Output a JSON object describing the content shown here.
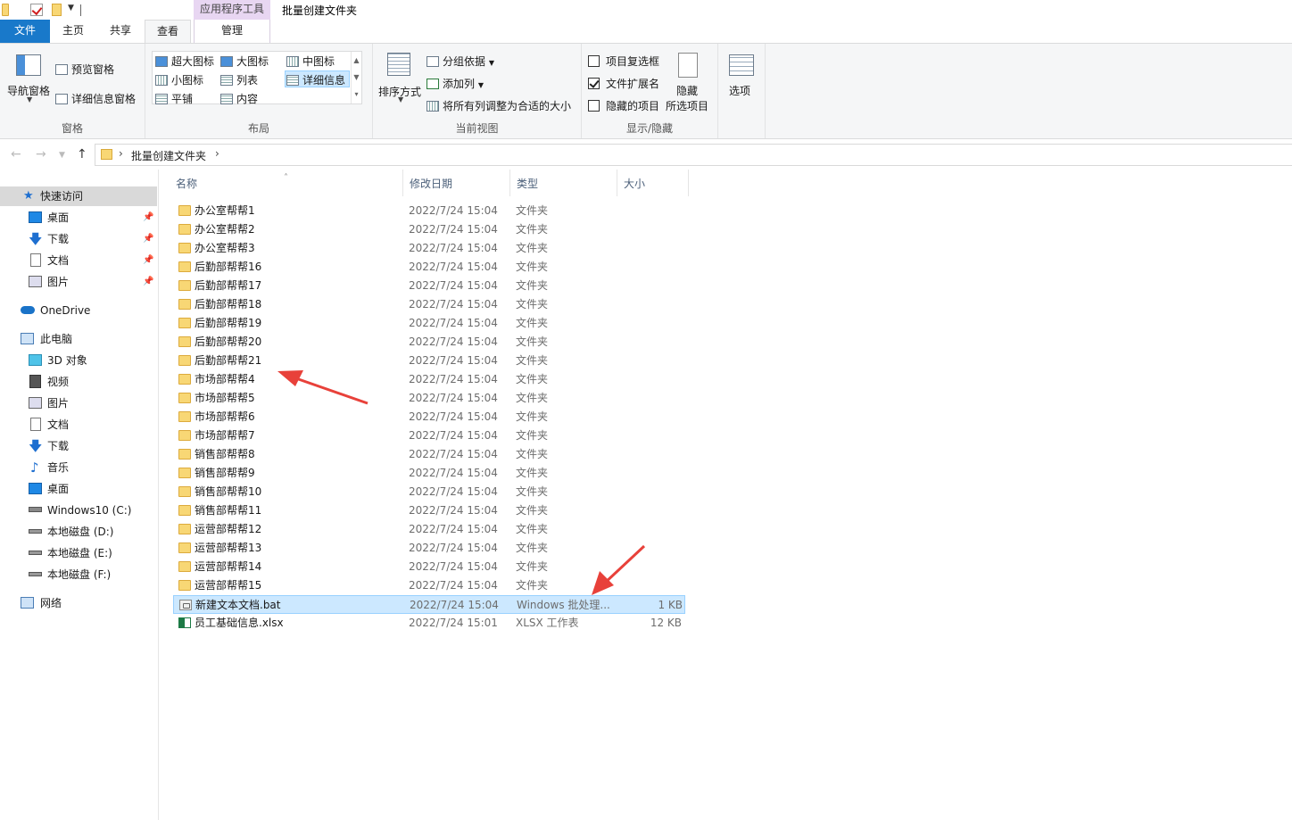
{
  "window": {
    "title": "批量创建文件夹",
    "context_tab_title": "应用程序工具"
  },
  "tabs": {
    "file": "文件",
    "home": "主页",
    "share": "共享",
    "view": "查看",
    "manage": "管理"
  },
  "ribbon": {
    "pane_group": {
      "nav_pane": "导航窗格",
      "preview_pane": "预览窗格",
      "details_pane": "详细信息窗格",
      "label": "窗格"
    },
    "layout_group": {
      "items": [
        "超大图标",
        "大图标",
        "中图标",
        "小图标",
        "列表",
        "详细信息",
        "平铺",
        "内容"
      ],
      "selected": "详细信息",
      "label": "布局"
    },
    "current_view_group": {
      "sort_by": "排序方式",
      "group_by": "分组依据",
      "add_columns": "添加列",
      "size_all_columns": "将所有列调整为合适的大小",
      "label": "当前视图"
    },
    "show_hide_group": {
      "item_checkboxes": {
        "label": "项目复选框",
        "checked": false
      },
      "file_extensions": {
        "label": "文件扩展名",
        "checked": true
      },
      "hidden_items": {
        "label": "隐藏的项目",
        "checked": false
      },
      "hide_selected_line1": "隐藏",
      "hide_selected_line2": "所选项目",
      "label": "显示/隐藏"
    },
    "options": "选项"
  },
  "address": {
    "path": "批量创建文件夹"
  },
  "sidebar": {
    "quick_access": "快速访问",
    "quick_items": [
      "桌面",
      "下载",
      "文档",
      "图片"
    ],
    "onedrive": "OneDrive",
    "this_pc": "此电脑",
    "pc_items": [
      "3D 对象",
      "视频",
      "图片",
      "文档",
      "下载",
      "音乐",
      "桌面",
      "Windows10 (C:)",
      "本地磁盘 (D:)",
      "本地磁盘 (E:)",
      "本地磁盘 (F:)"
    ],
    "network": "网络"
  },
  "columns": {
    "name": "名称",
    "date": "修改日期",
    "type": "类型",
    "size": "大小"
  },
  "files": [
    {
      "name": "办公室帮帮1",
      "date": "2022/7/24 15:04",
      "type": "文件夹",
      "size": "",
      "kind": "folder"
    },
    {
      "name": "办公室帮帮2",
      "date": "2022/7/24 15:04",
      "type": "文件夹",
      "size": "",
      "kind": "folder"
    },
    {
      "name": "办公室帮帮3",
      "date": "2022/7/24 15:04",
      "type": "文件夹",
      "size": "",
      "kind": "folder"
    },
    {
      "name": "后勤部帮帮16",
      "date": "2022/7/24 15:04",
      "type": "文件夹",
      "size": "",
      "kind": "folder"
    },
    {
      "name": "后勤部帮帮17",
      "date": "2022/7/24 15:04",
      "type": "文件夹",
      "size": "",
      "kind": "folder"
    },
    {
      "name": "后勤部帮帮18",
      "date": "2022/7/24 15:04",
      "type": "文件夹",
      "size": "",
      "kind": "folder"
    },
    {
      "name": "后勤部帮帮19",
      "date": "2022/7/24 15:04",
      "type": "文件夹",
      "size": "",
      "kind": "folder"
    },
    {
      "name": "后勤部帮帮20",
      "date": "2022/7/24 15:04",
      "type": "文件夹",
      "size": "",
      "kind": "folder"
    },
    {
      "name": "后勤部帮帮21",
      "date": "2022/7/24 15:04",
      "type": "文件夹",
      "size": "",
      "kind": "folder"
    },
    {
      "name": "市场部帮帮4",
      "date": "2022/7/24 15:04",
      "type": "文件夹",
      "size": "",
      "kind": "folder"
    },
    {
      "name": "市场部帮帮5",
      "date": "2022/7/24 15:04",
      "type": "文件夹",
      "size": "",
      "kind": "folder"
    },
    {
      "name": "市场部帮帮6",
      "date": "2022/7/24 15:04",
      "type": "文件夹",
      "size": "",
      "kind": "folder"
    },
    {
      "name": "市场部帮帮7",
      "date": "2022/7/24 15:04",
      "type": "文件夹",
      "size": "",
      "kind": "folder"
    },
    {
      "name": "销售部帮帮8",
      "date": "2022/7/24 15:04",
      "type": "文件夹",
      "size": "",
      "kind": "folder"
    },
    {
      "name": "销售部帮帮9",
      "date": "2022/7/24 15:04",
      "type": "文件夹",
      "size": "",
      "kind": "folder"
    },
    {
      "name": "销售部帮帮10",
      "date": "2022/7/24 15:04",
      "type": "文件夹",
      "size": "",
      "kind": "folder"
    },
    {
      "name": "销售部帮帮11",
      "date": "2022/7/24 15:04",
      "type": "文件夹",
      "size": "",
      "kind": "folder"
    },
    {
      "name": "运营部帮帮12",
      "date": "2022/7/24 15:04",
      "type": "文件夹",
      "size": "",
      "kind": "folder"
    },
    {
      "name": "运营部帮帮13",
      "date": "2022/7/24 15:04",
      "type": "文件夹",
      "size": "",
      "kind": "folder"
    },
    {
      "name": "运营部帮帮14",
      "date": "2022/7/24 15:04",
      "type": "文件夹",
      "size": "",
      "kind": "folder"
    },
    {
      "name": "运营部帮帮15",
      "date": "2022/7/24 15:04",
      "type": "文件夹",
      "size": "",
      "kind": "folder"
    },
    {
      "name": "新建文本文档.bat",
      "date": "2022/7/24 15:04",
      "type": "Windows 批处理...",
      "size": "1 KB",
      "kind": "bat",
      "selected": true
    },
    {
      "name": "员工基础信息.xlsx",
      "date": "2022/7/24 15:01",
      "type": "XLSX 工作表",
      "size": "12 KB",
      "kind": "xlsx"
    }
  ],
  "colors": {
    "accent": "#1979ca",
    "selection": "#cce8ff",
    "annotation_arrow": "#e8413a",
    "folder": "#f8d775",
    "context_tab": "#e8d6f2"
  }
}
